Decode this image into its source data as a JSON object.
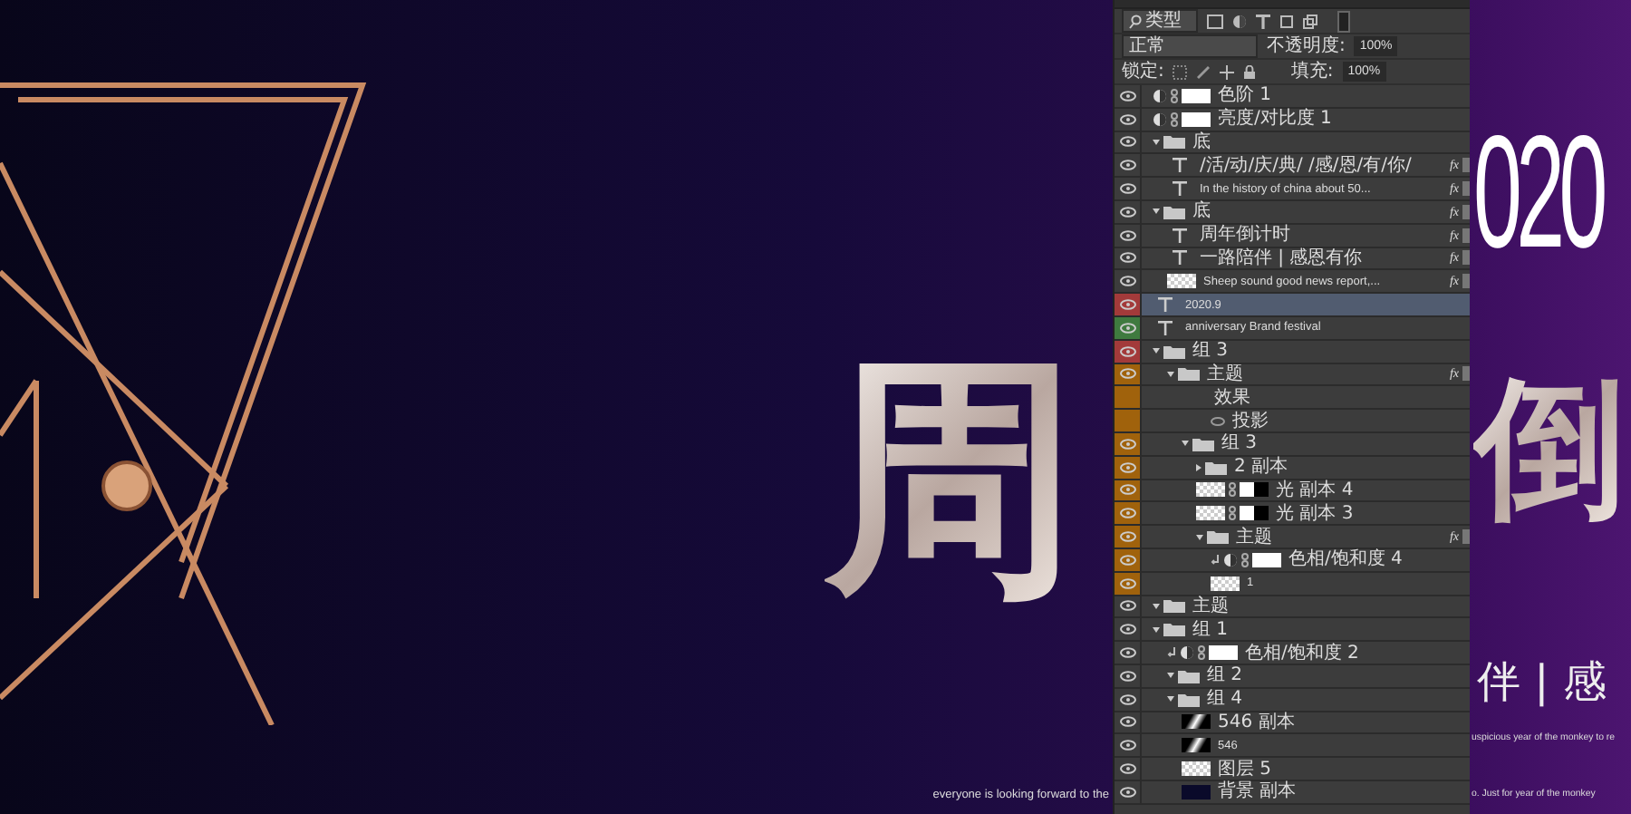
{
  "canvas": {
    "left_glyph": "周",
    "right_glyph": "倒",
    "year": "020",
    "slogan": "伴 | 感",
    "bottom_left": "everyone is looking forward to the",
    "bottom_right": [
      "uspicious year of the monkey to re",
      "o. Just for year of the monkey"
    ]
  },
  "layers_panel": {
    "filter": {
      "value": "类型"
    },
    "blend_mode": {
      "value": "正常"
    },
    "opacity": {
      "label": "不透明度:",
      "value": "100%"
    },
    "lock": {
      "label": "锁定:"
    },
    "fill": {
      "label": "填充:",
      "value": "100%"
    },
    "layers": [
      {
        "kind": "adjustment",
        "name": "色阶 1",
        "selected": false
      },
      {
        "kind": "adjustment",
        "name": "亮度/对比度 1",
        "selected": false
      },
      {
        "kind": "group",
        "name": "底",
        "expanded": true,
        "selected": false,
        "children": [
          {
            "kind": "text",
            "name": "/活/动/庆/典/  /感/恩/有/你/",
            "badge": "fx",
            "selected": false
          },
          {
            "kind": "text",
            "name": "In the history of china about 50...",
            "badge": "fx",
            "selected": false
          }
        ]
      },
      {
        "kind": "group",
        "name": "底",
        "expanded": true,
        "badge": "fx",
        "selected": false,
        "children": [
          {
            "kind": "text",
            "name": "周年倒计时",
            "badge": "fx",
            "selected": false
          },
          {
            "kind": "text",
            "name": "一路陪伴 | 感恩有你",
            "badge": "fx",
            "selected": false
          },
          {
            "kind": "image",
            "name": "Sheep sound good news report,...",
            "badge": "fx",
            "selected": false
          }
        ]
      },
      {
        "kind": "text",
        "name": "2020.9",
        "color": "#a33a3a",
        "selected": true
      },
      {
        "kind": "text",
        "name": "anniversary Brand festival",
        "color": "#3f7a3f",
        "selected": false
      },
      {
        "kind": "group",
        "name": "组 3",
        "color": "#a33a3a",
        "expanded": true,
        "selected": false,
        "children": [
          {
            "kind": "group",
            "name": "主题",
            "color": "#a0620c",
            "expanded": true,
            "badge": "fx",
            "selected": false,
            "effects": {
              "label": "效果",
              "items": [
                {
                  "label": "投影"
                }
              ]
            },
            "children": [
              {
                "kind": "group",
                "name": "组 3",
                "color": "#a0620c",
                "expanded": true,
                "selected": false,
                "children": [
                  {
                    "kind": "group",
                    "name": "2 副本",
                    "color": "#a0620c",
                    "expanded": false,
                    "selected": false
                  },
                  {
                    "kind": "image",
                    "name": "光 副本 4",
                    "color": "#a0620c",
                    "mask": true,
                    "selected": false
                  },
                  {
                    "kind": "image",
                    "name": "光 副本 3",
                    "color": "#a0620c",
                    "mask": true,
                    "selected": false
                  },
                  {
                    "kind": "group",
                    "name": "主题",
                    "color": "#a0620c",
                    "expanded": true,
                    "badge": "fx",
                    "selected": false,
                    "children": [
                      {
                        "kind": "adjustment",
                        "name": "色相/饱和度 4",
                        "color": "#a0620c",
                        "clipped": true,
                        "selected": false
                      },
                      {
                        "kind": "image",
                        "name": "1",
                        "color": "#a0620c",
                        "selected": false
                      }
                    ]
                  }
                ]
              }
            ]
          }
        ]
      },
      {
        "kind": "group",
        "name": "主题",
        "expanded": true,
        "selected": false
      },
      {
        "kind": "group",
        "name": "组 1",
        "expanded": true,
        "selected": false,
        "children": [
          {
            "kind": "adjustment",
            "name": "色相/饱和度 2",
            "clipped": true,
            "selected": false
          },
          {
            "kind": "group",
            "name": "组 2",
            "expanded": true,
            "selected": false
          },
          {
            "kind": "group",
            "name": "组 4",
            "expanded": true,
            "selected": false,
            "children": [
              {
                "kind": "photo",
                "name": "546 副本",
                "selected": false
              },
              {
                "kind": "photo",
                "name": "546",
                "selected": false
              },
              {
                "kind": "image",
                "name": "图层 5",
                "selected": false
              },
              {
                "kind": "fill",
                "name": "背景 副本",
                "selected": false
              }
            ]
          }
        ]
      }
    ]
  }
}
